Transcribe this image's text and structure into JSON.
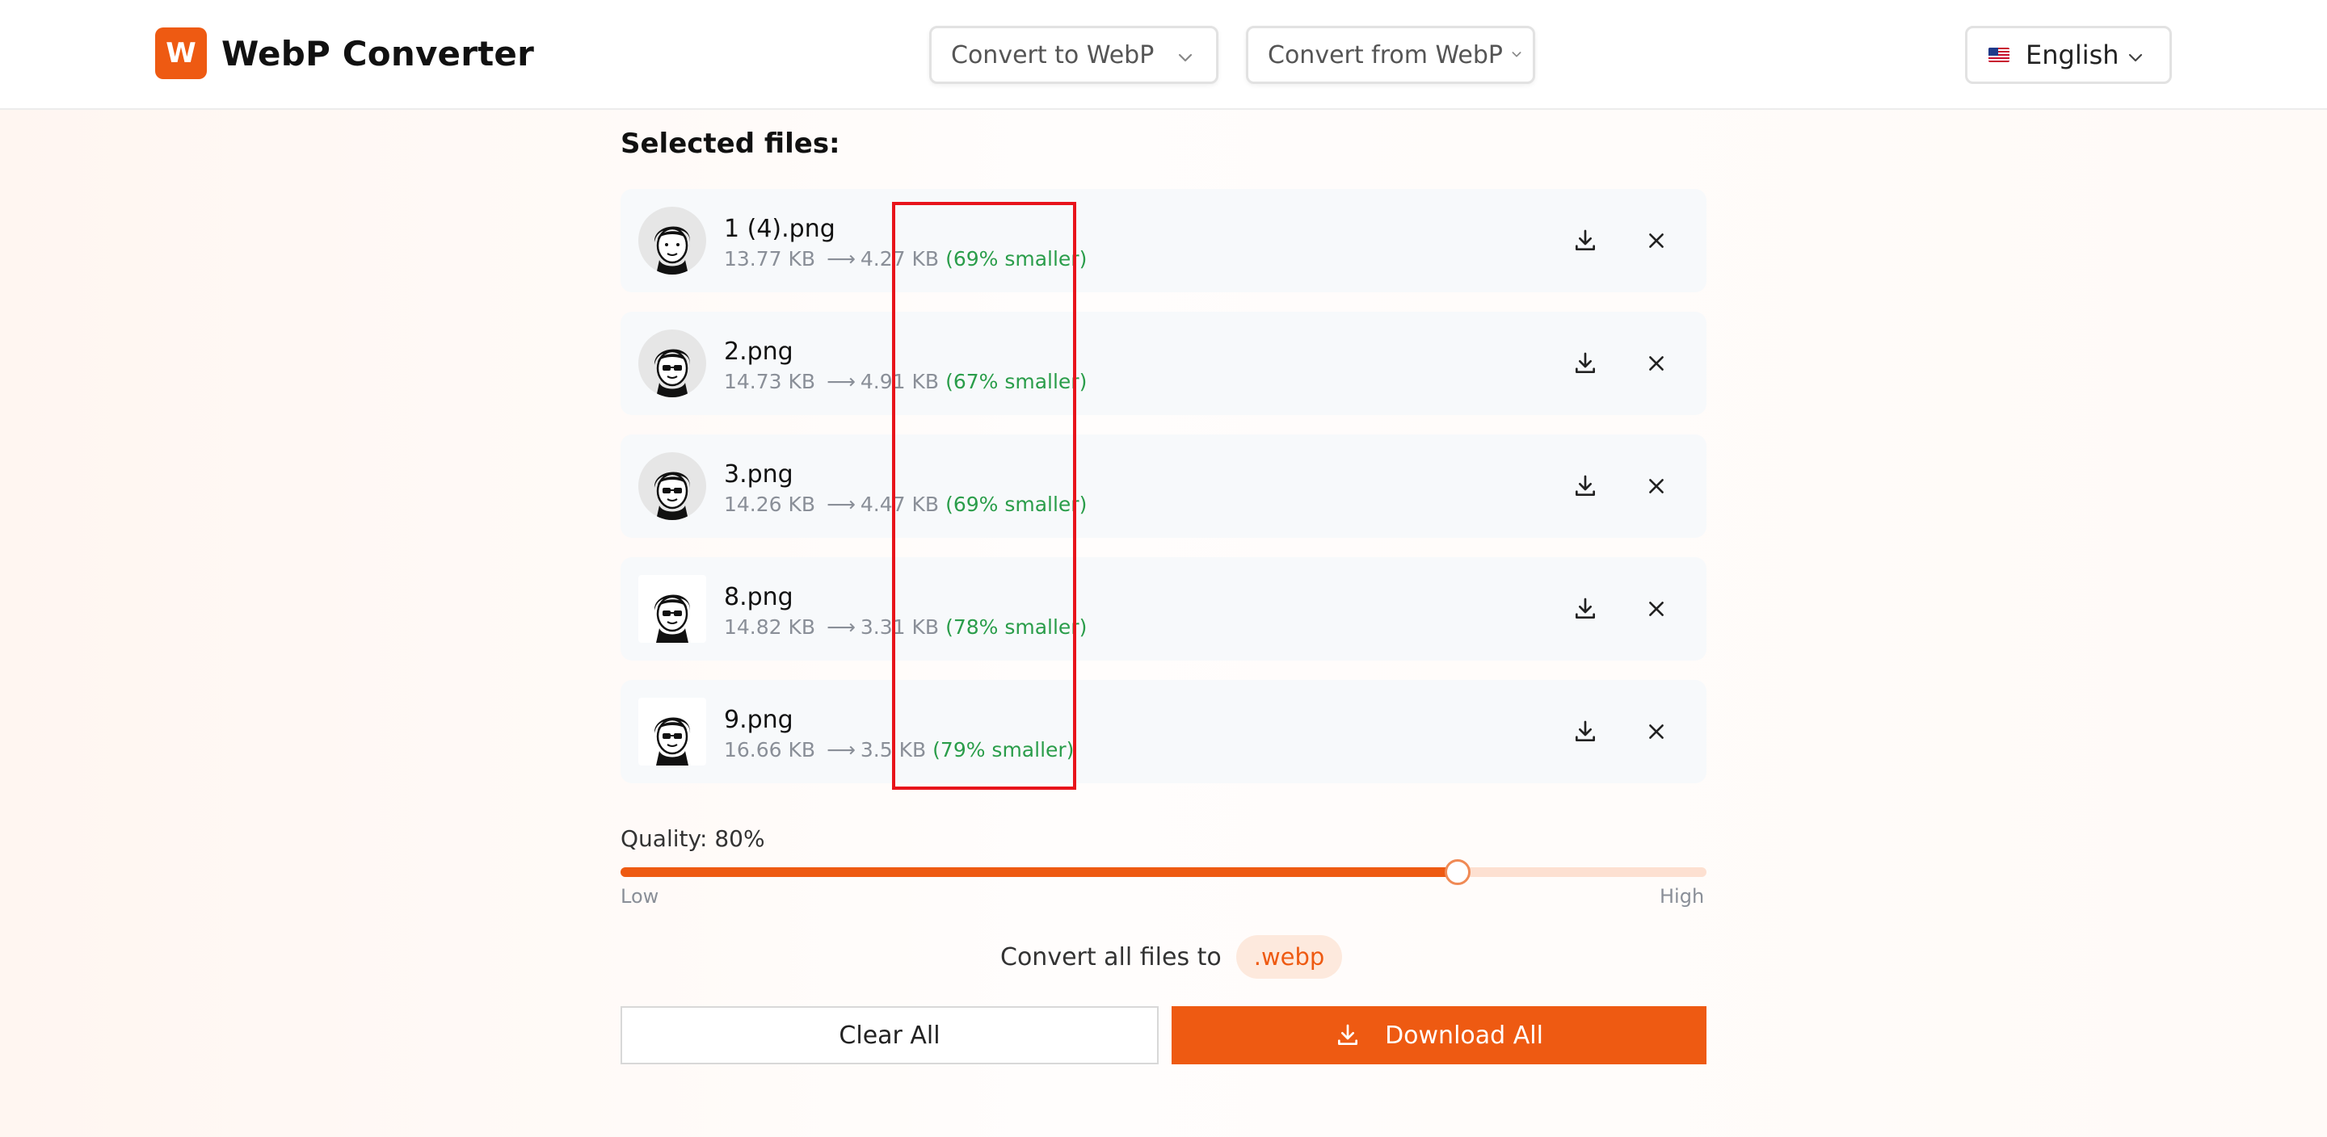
{
  "header": {
    "logo_letter": "W",
    "app_title": "WebP Converter",
    "nav": [
      {
        "label": "Convert to WebP",
        "icon": "chevron-down-icon"
      },
      {
        "label": "Convert from WebP",
        "icon": "chevron-down-icon"
      }
    ],
    "language": {
      "flag": "us-flag-icon",
      "label": "English"
    }
  },
  "files_section": {
    "title": "Selected files:",
    "files": [
      {
        "name": "1 (4).png",
        "original": "13.77 KB",
        "converted": "4.27 KB",
        "saving": "(69% smaller)"
      },
      {
        "name": "2.png",
        "original": "14.73 KB",
        "converted": "4.91 KB",
        "saving": "(67% smaller)"
      },
      {
        "name": "3.png",
        "original": "14.26 KB",
        "converted": "4.47 KB",
        "saving": "(69% smaller)"
      },
      {
        "name": "8.png",
        "original": "14.82 KB",
        "converted": "3.31 KB",
        "saving": "(78% smaller)"
      },
      {
        "name": "9.png",
        "original": "16.66 KB",
        "converted": "3.5 KB",
        "saving": "(79% smaller)"
      }
    ],
    "arrow": "⟶"
  },
  "quality": {
    "label": "Quality: 80%",
    "value": 80,
    "low_label": "Low",
    "high_label": "High"
  },
  "convert": {
    "text": "Convert all files to",
    "format": ".webp"
  },
  "actions": {
    "clear_label": "Clear All",
    "download_label": "Download All"
  },
  "colors": {
    "accent": "#ee5a12",
    "saving_green": "#2a9d4a",
    "highlight_red": "#e8141b"
  }
}
